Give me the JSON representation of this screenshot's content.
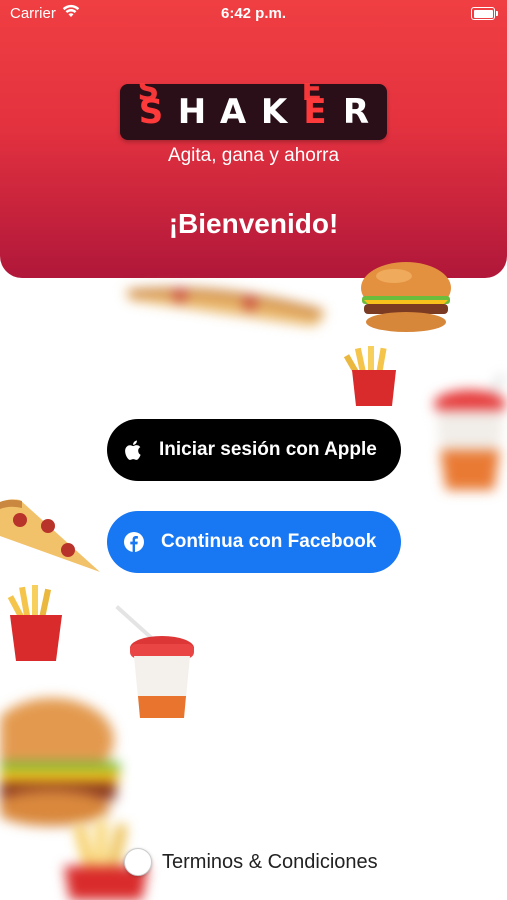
{
  "status_bar": {
    "carrier": "Carrier",
    "time": "6:42 p.m."
  },
  "header": {
    "logo_letters": [
      "S",
      "H",
      "A",
      "K",
      "E",
      "R"
    ],
    "tagline": "Agita, gana y ahorra",
    "welcome": "¡Bienvenido!"
  },
  "buttons": {
    "apple_label": "Iniciar sesión con Apple",
    "facebook_label": "Continua con Facebook"
  },
  "terms": {
    "label": "Terminos & Condiciones",
    "checked": false
  },
  "colors": {
    "header_top": "#f03f42",
    "header_bottom": "#b0173a",
    "apple_button": "#000000",
    "facebook_button": "#1877f2"
  }
}
